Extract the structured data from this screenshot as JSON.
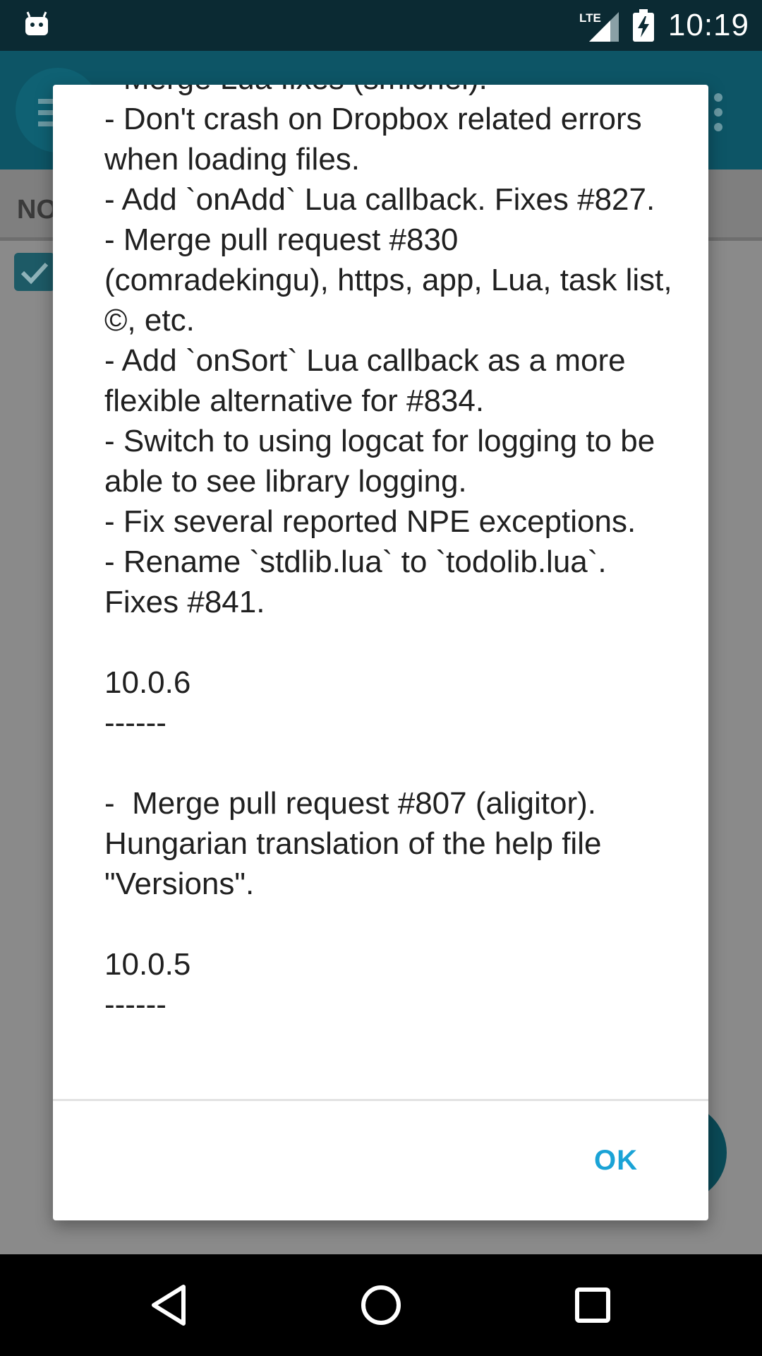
{
  "status_bar": {
    "time": "10:19",
    "left_icon": "android-debug-icon",
    "network_icon": "lte-signal-icon",
    "network_label": "LTE",
    "battery_icon": "battery-charging-icon",
    "background": "#0b2a33"
  },
  "app": {
    "toolbar_color": "#0d5566",
    "filter_label": "NO",
    "menu_icon": "hamburger-menu-icon",
    "overflow_icon": "overflow-menu-icon",
    "fab_color": "#0a4a57"
  },
  "dialog": {
    "text": "- Merge Lua fixes (smichel).\n- Don't crash on Dropbox related errors when loading files.\n- Add `onAdd` Lua callback. Fixes #827.\n- Merge pull request #830 (comradekingu), https, app, Lua, task list, ©, etc.\n- Add `onSort` Lua callback as a more flexible alternative for #834.\n- Switch to using logcat for logging to be able to see library logging.\n- Fix several reported NPE exceptions.\n- Rename `stdlib.lua` to `todolib.lua`. Fixes #841.\n\n10.0.6\n------\n\n-  Merge pull request #807 (aligitor). Hungarian translation of the help file \"Versions\".\n\n10.0.5\n------",
    "ok_label": "OK",
    "accent_color": "#1aa3d6"
  },
  "nav_bar": {
    "back_icon": "back-triangle-icon",
    "home_icon": "home-circle-icon",
    "recent_icon": "recent-apps-square-icon"
  }
}
